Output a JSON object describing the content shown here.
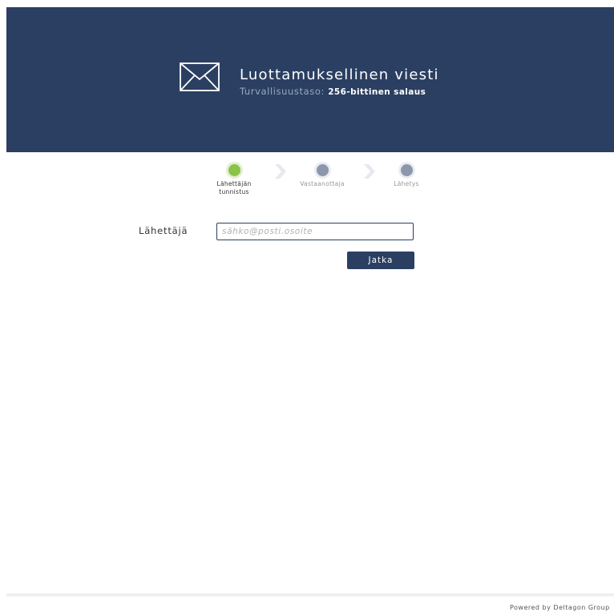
{
  "header": {
    "title": "Luottamuksellinen viesti",
    "subtitle_prefix": "Turvallisuustaso:",
    "security_level": "256-bittinen salaus",
    "icon": "envelope-icon",
    "background_color": "#2a3f62"
  },
  "steps": [
    {
      "line1": "Lähettäjän",
      "line2": "tunnistus",
      "state": "active"
    },
    {
      "line1": "Vastaanottaja",
      "line2": "",
      "state": "inactive"
    },
    {
      "line1": "Lähetys",
      "line2": "",
      "state": "inactive"
    }
  ],
  "form": {
    "sender_label": "Lähettäjä",
    "email_placeholder": "sähko@posti.osoite",
    "email_value": "",
    "continue_label": "Jatka"
  },
  "footer": {
    "powered_by": "Powered by Deltagon Group"
  },
  "colors": {
    "accent": "#2a3f62",
    "step_active": "#8bc34a",
    "step_inactive": "#8d97ab"
  }
}
